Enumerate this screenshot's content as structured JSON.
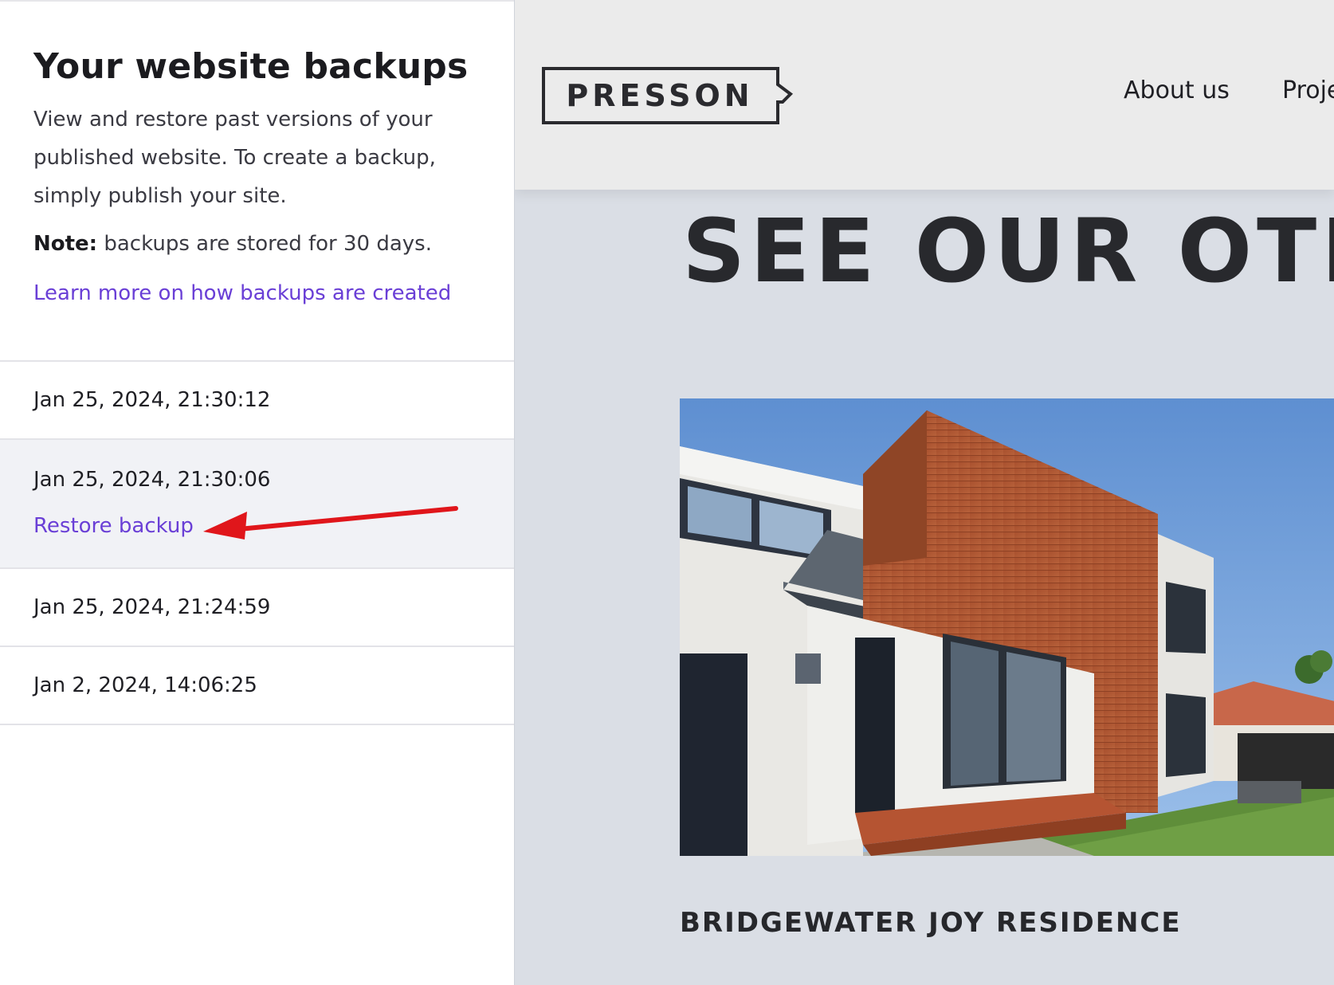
{
  "panel": {
    "title": "Your website backups",
    "description": "View and restore past versions of your published website. To create a backup, simply publish your site.",
    "note_label": "Note:",
    "note_text": " backups are stored for 30 days.",
    "learn_more": "Learn more on how backups are created",
    "link_color": "#6a3fd6"
  },
  "backups": [
    {
      "date": "Jan 25, 2024, 21:30:12"
    },
    {
      "date": "Jan 25, 2024, 21:30:06",
      "action": "Restore backup"
    },
    {
      "date": "Jan 25, 2024, 21:24:59"
    },
    {
      "date": "Jan 2, 2024, 14:06:25"
    }
  ],
  "site": {
    "logo_text": "PRESSON",
    "nav": {
      "about": "About us",
      "projects": "Proje"
    },
    "hero_title": "SEE OUR OTH",
    "project_name": "BRIDGEWATER JOY RESIDENCE"
  },
  "annotation": {
    "arrow_color": "#e0161b",
    "icon": "red-arrow-icon"
  }
}
